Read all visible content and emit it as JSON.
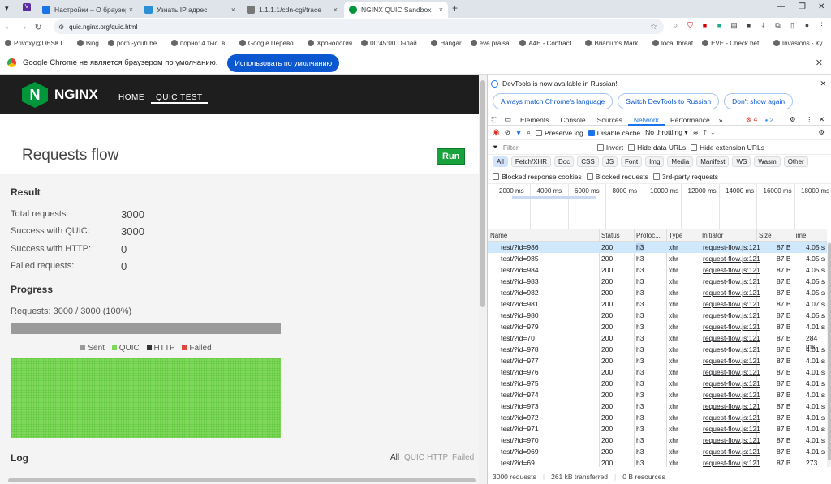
{
  "tabs": [
    {
      "title": "Настройки – О браузере",
      "color": "#1a73e8"
    },
    {
      "title": "Узнать IP адрес",
      "color": "#2a8fd4"
    },
    {
      "title": "1.1.1.1/cdn-cgi/trace",
      "color": "#777"
    },
    {
      "title": "NGINX QUIC Sandbox",
      "color": "#009639"
    }
  ],
  "url": "quic.nginx.org/quic.html",
  "bookmarks": [
    "Privoxy@DESKT...",
    "Bing",
    "porn -youtube...",
    "порно: 4 тыс. в...",
    "Google Перево...",
    "Хронология",
    "00:45:00 Онлай...",
    "Hangar",
    "eve praisal",
    "A4E - Contract...",
    "Brianums Mark...",
    "local threat",
    "EVE - Check bef...",
    "Invasions - Ку..."
  ],
  "infobar": {
    "text": "Google Chrome не является браузером по умолчанию.",
    "button": "Использовать по умолчанию"
  },
  "page": {
    "logo": "NGINX",
    "nav": [
      "HOME",
      "QUIC TEST"
    ],
    "title": "Requests flow",
    "run": "Run",
    "result_heading": "Result",
    "results": [
      {
        "label": "Total requests:",
        "value": "3000"
      },
      {
        "label": "Success with QUIC:",
        "value": "3000"
      },
      {
        "label": "Success with HTTP:",
        "value": "0"
      },
      {
        "label": "Failed requests:",
        "value": "0"
      }
    ],
    "progress_heading": "Progress",
    "progress_text": "Requests: 3000 / 3000 (100%)",
    "progress_fraction": 1.0,
    "legend": [
      {
        "name": "Sent",
        "color": "#9a9a9a"
      },
      {
        "name": "QUIC",
        "color": "#7fd85c"
      },
      {
        "name": "HTTP",
        "color": "#333333"
      },
      {
        "name": "Failed",
        "color": "#e0483e"
      }
    ],
    "log_heading": "Log",
    "log_filters": [
      "All",
      "QUIC",
      "HTTP",
      "Failed"
    ]
  },
  "devtools": {
    "info": "DevTools is now available in Russian!",
    "btns": [
      "Always match Chrome's language",
      "Switch DevTools to Russian",
      "Don't show again"
    ],
    "tabs": [
      "Elements",
      "Console",
      "Sources",
      "Network",
      "Performance"
    ],
    "errors": "4",
    "messages": "2",
    "preserve": "Preserve log",
    "disable_cache": "Disable cache",
    "throttle": "No throttling",
    "filter": "Filter",
    "invert": "Invert",
    "hide_data": "Hide data URLs",
    "hide_ext": "Hide extension URLs",
    "types": [
      "All",
      "Fetch/XHR",
      "Doc",
      "CSS",
      "JS",
      "Font",
      "Img",
      "Media",
      "Manifest",
      "WS",
      "Wasm",
      "Other"
    ],
    "blocked_cookies": "Blocked response cookies",
    "blocked_req": "Blocked requests",
    "third": "3rd-party requests",
    "timeline": [
      "2000 ms",
      "4000 ms",
      "6000 ms",
      "8000 ms",
      "10000 ms",
      "12000 ms",
      "14000 ms",
      "16000 ms",
      "18000 ms"
    ],
    "columns": [
      "Name",
      "Status",
      "Protoc...",
      "Type",
      "Initiator",
      "Size",
      "Time"
    ],
    "rows": [
      [
        "test/?id=986",
        "200",
        "h3",
        "xhr",
        "request-flow.js:121",
        "87 B",
        "4.05 s"
      ],
      [
        "test/?id=985",
        "200",
        "h3",
        "xhr",
        "request-flow.js:121",
        "87 B",
        "4.05 s"
      ],
      [
        "test/?id=984",
        "200",
        "h3",
        "xhr",
        "request-flow.js:121",
        "87 B",
        "4.05 s"
      ],
      [
        "test/?id=983",
        "200",
        "h3",
        "xhr",
        "request-flow.js:121",
        "87 B",
        "4.05 s"
      ],
      [
        "test/?id=982",
        "200",
        "h3",
        "xhr",
        "request-flow.js:121",
        "87 B",
        "4.05 s"
      ],
      [
        "test/?id=981",
        "200",
        "h3",
        "xhr",
        "request-flow.js:121",
        "87 B",
        "4.07 s"
      ],
      [
        "test/?id=980",
        "200",
        "h3",
        "xhr",
        "request-flow.js:121",
        "87 B",
        "4.05 s"
      ],
      [
        "test/?id=979",
        "200",
        "h3",
        "xhr",
        "request-flow.js:121",
        "87 B",
        "4.01 s"
      ],
      [
        "test/?id=70",
        "200",
        "h3",
        "xhr",
        "request-flow.js:121",
        "87 B",
        "284 ms"
      ],
      [
        "test/?id=978",
        "200",
        "h3",
        "xhr",
        "request-flow.js:121",
        "87 B",
        "4.01 s"
      ],
      [
        "test/?id=977",
        "200",
        "h3",
        "xhr",
        "request-flow.js:121",
        "87 B",
        "4.01 s"
      ],
      [
        "test/?id=976",
        "200",
        "h3",
        "xhr",
        "request-flow.js:121",
        "87 B",
        "4.01 s"
      ],
      [
        "test/?id=975",
        "200",
        "h3",
        "xhr",
        "request-flow.js:121",
        "87 B",
        "4.01 s"
      ],
      [
        "test/?id=974",
        "200",
        "h3",
        "xhr",
        "request-flow.js:121",
        "87 B",
        "4.01 s"
      ],
      [
        "test/?id=973",
        "200",
        "h3",
        "xhr",
        "request-flow.js:121",
        "87 B",
        "4.01 s"
      ],
      [
        "test/?id=972",
        "200",
        "h3",
        "xhr",
        "request-flow.js:121",
        "87 B",
        "4.01 s"
      ],
      [
        "test/?id=971",
        "200",
        "h3",
        "xhr",
        "request-flow.js:121",
        "87 B",
        "4.01 s"
      ],
      [
        "test/?id=970",
        "200",
        "h3",
        "xhr",
        "request-flow.js:121",
        "87 B",
        "4.01 s"
      ],
      [
        "test/?id=969",
        "200",
        "h3",
        "xhr",
        "request-flow.js:121",
        "87 B",
        "4.01 s"
      ],
      [
        "test/?id=69",
        "200",
        "h3",
        "xhr",
        "request-flow.js:121",
        "87 B",
        "273 ms"
      ]
    ],
    "status": [
      "3000 requests",
      "261 kB transferred",
      "0 B resources"
    ]
  }
}
